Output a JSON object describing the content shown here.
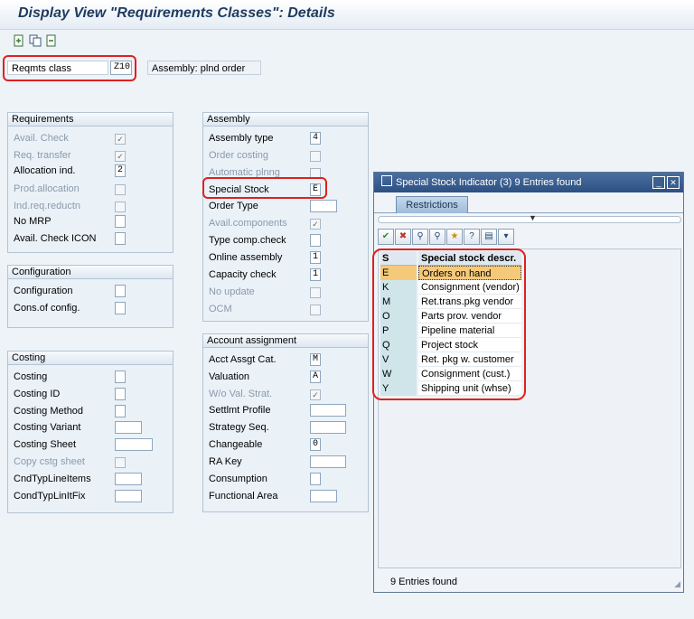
{
  "title": "Display View \"Requirements Classes\": Details",
  "toolbar": {
    "icons": [
      "new-entries-icon",
      "copy-icon",
      "delete-icon"
    ]
  },
  "header": {
    "reqmts_label": "Reqmts class",
    "reqmts_value": "Z10",
    "reqmts_desc": "Assembly: plnd order"
  },
  "requirements": {
    "title": "Requirements",
    "rows": [
      {
        "label": "Avail. Check",
        "value": "✓",
        "disabled": true
      },
      {
        "label": "Req. transfer",
        "value": "✓",
        "disabled": true
      },
      {
        "label": "Allocation ind.",
        "value": "2",
        "disabled": false
      },
      {
        "label": "Prod.allocation",
        "value": "",
        "disabled": true
      },
      {
        "label": "Ind.req.reductn",
        "value": "",
        "disabled": true
      },
      {
        "label": "No MRP",
        "value": "",
        "disabled": false
      },
      {
        "label": "Avail. Check ICON",
        "value": "",
        "disabled": false
      }
    ]
  },
  "configuration": {
    "title": "Configuration",
    "rows": [
      {
        "label": "Configuration",
        "value": ""
      },
      {
        "label": "Cons.of config.",
        "value": ""
      }
    ]
  },
  "costing": {
    "title": "Costing",
    "rows": [
      {
        "label": "Costing",
        "value": ""
      },
      {
        "label": "Costing ID",
        "value": ""
      },
      {
        "label": "Costing Method",
        "value": ""
      },
      {
        "label": "Costing Variant",
        "value": ""
      },
      {
        "label": "Costing Sheet",
        "value": ""
      },
      {
        "label": "Copy cstg sheet",
        "value": ""
      },
      {
        "label": "CndTypLineItems",
        "value": ""
      },
      {
        "label": "CondTypLinItFix",
        "value": ""
      }
    ]
  },
  "assembly": {
    "title": "Assembly",
    "rows": [
      {
        "label": "Assembly type",
        "value": "4"
      },
      {
        "label": "Order costing",
        "value": ""
      },
      {
        "label": "Automatic plnng",
        "value": ""
      },
      {
        "label": "Special Stock",
        "value": "E"
      },
      {
        "label": "Order Type",
        "value": ""
      },
      {
        "label": "Avail.components",
        "value": "✓"
      },
      {
        "label": "Type comp.check",
        "value": ""
      },
      {
        "label": "Online assembly",
        "value": "1"
      },
      {
        "label": "Capacity check",
        "value": "1"
      },
      {
        "label": "No update",
        "value": ""
      },
      {
        "label": "OCM",
        "value": ""
      }
    ]
  },
  "account": {
    "title": "Account assignment",
    "rows": [
      {
        "label": "Acct Assgt Cat.",
        "value": "M"
      },
      {
        "label": "Valuation",
        "value": "A"
      },
      {
        "label": "W/o Val. Strat.",
        "value": "✓"
      },
      {
        "label": "Settlmt Profile",
        "value": ""
      },
      {
        "label": "Strategy Seq.",
        "value": ""
      },
      {
        "label": "Changeable",
        "value": "0"
      },
      {
        "label": "RA Key",
        "value": ""
      },
      {
        "label": "Consumption",
        "value": ""
      },
      {
        "label": "Functional Area",
        "value": ""
      }
    ]
  },
  "popup": {
    "title": "Special Stock Indicator (3)   9 Entries found",
    "tab": "Restrictions",
    "columns": [
      "S",
      "Special stock descr."
    ],
    "rows": [
      [
        "E",
        "Orders on hand"
      ],
      [
        "K",
        "Consignment (vendor)"
      ],
      [
        "M",
        "Ret.trans.pkg vendor"
      ],
      [
        "O",
        "Parts prov. vendor"
      ],
      [
        "P",
        "Pipeline material"
      ],
      [
        "Q",
        "Project stock"
      ],
      [
        "V",
        "Ret. pkg w. customer"
      ],
      [
        "W",
        "Consignment (cust.)"
      ],
      [
        "Y",
        "Shipping unit (whse)"
      ]
    ],
    "status": "9 Entries found"
  },
  "colors": {
    "highlight": "#e02020",
    "selected_row": "#f5c97a",
    "title_blue": "#1f3a5f"
  }
}
